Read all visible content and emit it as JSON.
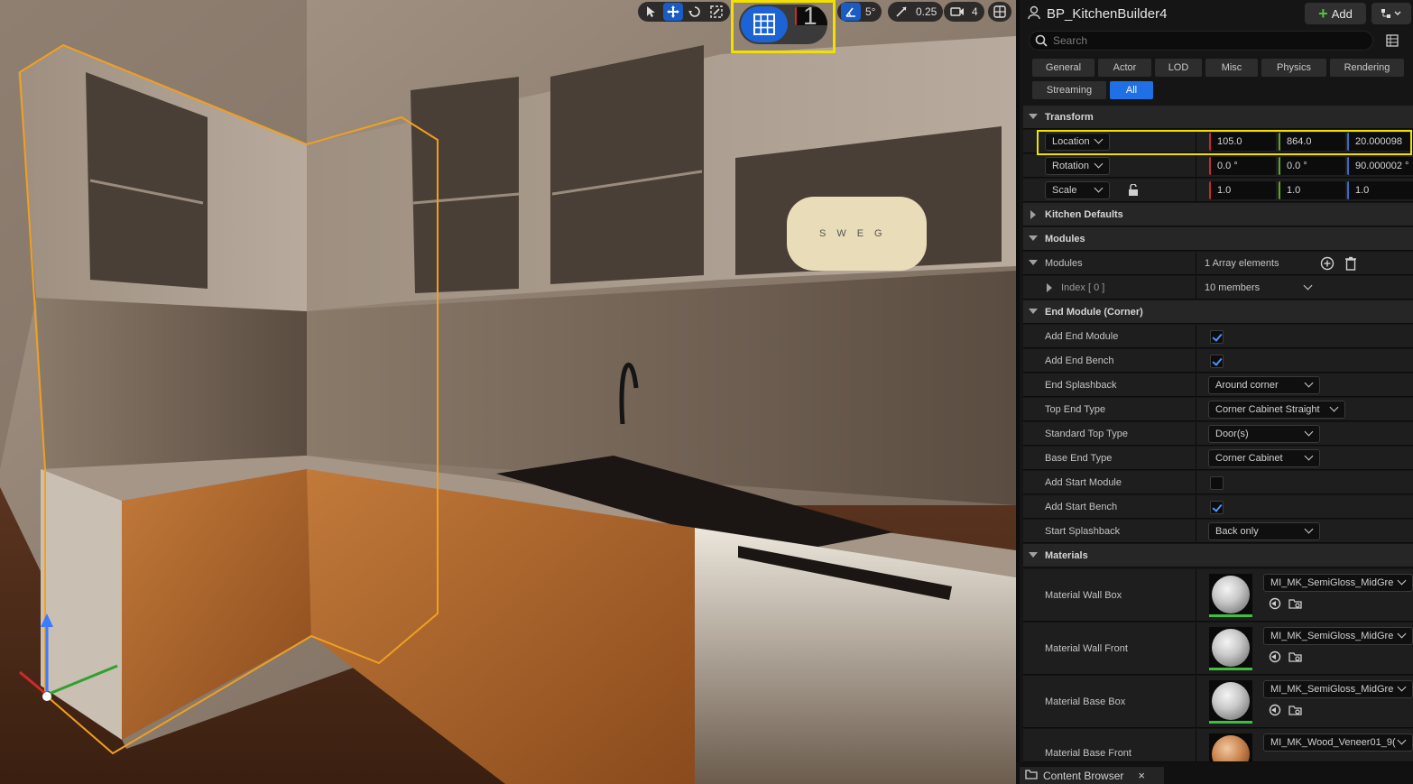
{
  "viewport": {
    "toolbar": {
      "rotation_snap": "5°",
      "scale_snap": "0.25",
      "camera_speed": "4",
      "grid_snap_value": "1"
    },
    "scene": {
      "toaster_brand": "SWEG"
    }
  },
  "details": {
    "title": "BP_KitchenBuilder4",
    "add_label": "Add",
    "search_placeholder": "Search",
    "filters": [
      "General",
      "Actor",
      "LOD",
      "Misc",
      "Physics",
      "Rendering",
      "Streaming",
      "All"
    ],
    "active_filter": "All",
    "transform": {
      "label": "Transform",
      "location": {
        "label": "Location",
        "x": "105.0",
        "y": "864.0",
        "z": "20.000098"
      },
      "rotation": {
        "label": "Rotation",
        "x": "0.0 °",
        "y": "0.0 °",
        "z": "90.000002 °"
      },
      "scale": {
        "label": "Scale",
        "x": "1.0",
        "y": "1.0",
        "z": "1.0"
      }
    },
    "kitchen_defaults": "Kitchen Defaults",
    "modules_section": "Modules",
    "modules": {
      "label": "Modules",
      "count": "1 Array elements",
      "index_label": "Index [ 0 ]",
      "members": "10 members"
    },
    "end_module": {
      "label": "End Module (Corner)",
      "add_end_module": {
        "label": "Add End Module",
        "checked": true
      },
      "add_end_bench": {
        "label": "Add End Bench",
        "checked": true
      },
      "end_splashback": {
        "label": "End Splashback",
        "value": "Around corner"
      },
      "top_end_type": {
        "label": "Top End Type",
        "value": "Corner Cabinet Straight"
      },
      "standard_top_type": {
        "label": "Standard Top Type",
        "value": "Door(s)"
      },
      "base_end_type": {
        "label": "Base End Type",
        "value": "Corner Cabinet"
      },
      "add_start_module": {
        "label": "Add Start Module",
        "checked": false
      },
      "add_start_bench": {
        "label": "Add Start Bench",
        "checked": true
      },
      "start_splashback": {
        "label": "Start Splashback",
        "value": "Back only"
      }
    },
    "materials": {
      "label": "Materials",
      "items": [
        {
          "label": "Material Wall Box",
          "value": "MI_MK_SemiGloss_MidGre"
        },
        {
          "label": "Material Wall Front",
          "value": "MI_MK_SemiGloss_MidGre"
        },
        {
          "label": "Material Base Box",
          "value": "MI_MK_SemiGloss_MidGre"
        },
        {
          "label": "Material Base Front",
          "value": "MI_MK_Wood_Veneer01_9("
        }
      ]
    },
    "content_browser": "Content Browser"
  },
  "colors": {
    "accent": "#1f6fe5",
    "highlight": "#f2e100",
    "axis_x": "#c52d2d",
    "axis_y": "#62a326",
    "axis_z": "#3a6ac8"
  }
}
